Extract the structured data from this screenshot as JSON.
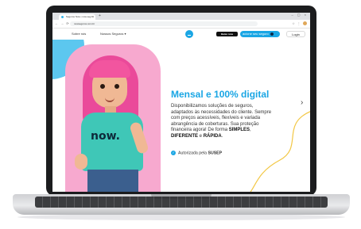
{
  "browser": {
    "tab_title": "Seguros Now | now.seg.br",
    "url": "nowseguros.com.br"
  },
  "site_header": {
    "nav": [
      "Sobre nós",
      "Nossos Seguros ▾"
    ],
    "store_badge": "Baixe now",
    "cta_label": "acione seu seguro",
    "login_label": "Login"
  },
  "hero": {
    "shirt_logo": "now.",
    "headline": "Mensal e 100% digital",
    "body_intro": "Disponibilizamos soluções de seguros, adaptados às necessidades do cliente. Sempre com preços acessíveis, flexíveis e variada abrangência de coberturas. Sua proteção financeira agora! De forma ",
    "emphasis": [
      "SIMPLES",
      "DIFERENTE",
      "RÁPIDA"
    ],
    "sep1": ", ",
    "sep2": " e ",
    "end": ".",
    "authorized_prefix": "Autorizada pela ",
    "authorized_org": "SUSEP",
    "next_arrow": "›"
  },
  "colors": {
    "accent": "#1aa6e4",
    "pink": "#f7a9cf",
    "blue_blob": "#5cc7ef",
    "squiggle": "#f2c744"
  }
}
